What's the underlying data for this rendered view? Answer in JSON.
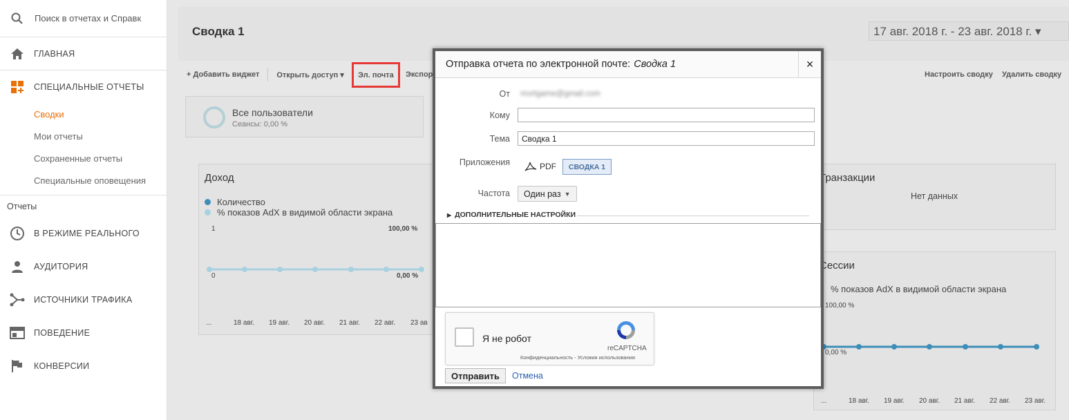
{
  "sidebar": {
    "search_placeholder": "Поиск в отчетах и Справк",
    "home": "ГЛАВНАЯ",
    "custom_reports": "СПЕЦИАЛЬНЫЕ ОТЧЕТЫ",
    "sub_items": [
      "Сводки",
      "Мои отчеты",
      "Сохраненные отчеты",
      "Специальные оповещения"
    ],
    "reports_heading": "Отчеты",
    "report_items": [
      "В РЕЖИМЕ РЕАЛЬНОГО",
      "АУДИТОРИЯ",
      "ИСТОЧНИКИ ТРАФИКА",
      "ПОВЕДЕНИЕ",
      "КОНВЕРСИИ"
    ]
  },
  "header": {
    "title": "Сводка 1",
    "date_range": "17 авг. 2018 г. - 23 авг. 2018 г. ▾"
  },
  "toolbar": {
    "add_widget": "+ Добавить виджет",
    "share": "Открыть доступ",
    "email": "Эл. почта",
    "export": "Экспор",
    "customize": "Настроить сводку",
    "delete": "Удалить сводку"
  },
  "segment": {
    "name": "Все пользователи",
    "sub": "Сеансы: 0,00 %"
  },
  "widget_income": {
    "title": "Доход",
    "legend": [
      "Количество",
      "% показов AdX в видимой области экрана"
    ],
    "y_left_top": "1",
    "y_left_bottom": "0",
    "y_right_top": "100,00 %",
    "y_right_bottom": "0,00 %",
    "x_labels": [
      "...",
      "18 авг.",
      "19 авг.",
      "20 авг.",
      "21 авг.",
      "22 авг.",
      "23 ав"
    ]
  },
  "widget_transactions": {
    "title": "Транзакции",
    "empty": "Нет данных"
  },
  "widget_sessions": {
    "title": "Сессии",
    "legend": "% показов AdX в видимой области экрана",
    "y_top": "100,00 %",
    "y_bottom": "0,00 %",
    "x_labels": [
      "...",
      "18 авг.",
      "19 авг.",
      "20 авг.",
      "21 авг.",
      "22 авг.",
      "23 авг."
    ]
  },
  "modal": {
    "title": "Отправка отчета по электронной почте:",
    "title_italic": "Сводка 1",
    "close": "×",
    "from_label": "От",
    "from_value": "mortgame@gmail.com",
    "to_label": "Кому",
    "to_value": "",
    "subject_label": "Тема",
    "subject_value": "Сводка 1",
    "attachments_label": "Приложения",
    "pdf_label": "PDF",
    "attachment_chip": "СВОДКА 1",
    "frequency_label": "Частота",
    "frequency_value": "Один раз",
    "advanced": "ДОПОЛНИТЕЛЬНЫЕ НАСТРОЙКИ",
    "captcha_label": "Я не робот",
    "captcha_brand": "reCAPTCHA",
    "captcha_links": "Конфиденциальность - Условия использования",
    "send": "Отправить",
    "cancel": "Отмена"
  },
  "colors": {
    "accent_orange": "#e8710a",
    "series_blue": "#3d8eb9",
    "series_light": "#a8d1df",
    "highlight_red": "#e53935"
  }
}
